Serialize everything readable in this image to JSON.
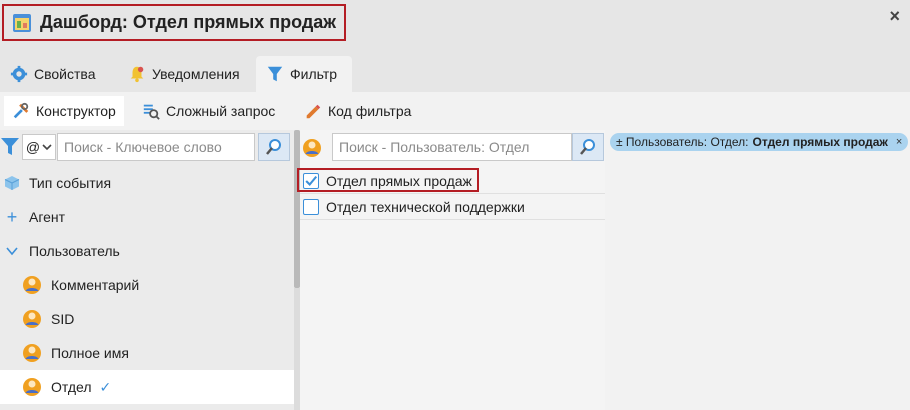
{
  "window": {
    "title": "Дашборд: Отдел прямых продаж",
    "close": "×"
  },
  "tabs": [
    {
      "label": "Свойства",
      "icon": "gear-icon"
    },
    {
      "label": "Уведомления",
      "icon": "bell-icon"
    },
    {
      "label": "Фильтр",
      "icon": "funnel-icon",
      "active": true
    }
  ],
  "subtabs": [
    {
      "label": "Конструктор",
      "icon": "tools-icon",
      "active": true
    },
    {
      "label": "Сложный запрос",
      "icon": "query-icon"
    },
    {
      "label": "Код фильтра",
      "icon": "code-icon"
    }
  ],
  "left": {
    "operator": "@",
    "search_placeholder": "Поиск - Ключевое слово",
    "items": [
      {
        "label": "Тип события",
        "icon": "cube-icon"
      },
      {
        "label": "Агент",
        "icon": "plus-icon"
      },
      {
        "label": "Пользователь",
        "icon": "chevron-down-icon"
      },
      {
        "label": "Комментарий",
        "icon": "user-icon"
      },
      {
        "label": "SID",
        "icon": "user-icon"
      },
      {
        "label": "Полное имя",
        "icon": "user-icon"
      },
      {
        "label": "Отдел",
        "icon": "user-icon",
        "selected": true
      }
    ],
    "selected_mark": "✓"
  },
  "middle": {
    "search_placeholder": "Поиск - Пользователь: Отдел",
    "options": [
      {
        "label": "Отдел прямых продаж",
        "checked": true
      },
      {
        "label": "Отдел технической поддержки",
        "checked": false
      }
    ]
  },
  "right": {
    "chip": {
      "prefix": "± Пользователь: Отдел:",
      "value": "Отдел прямых продаж",
      "remove": "×"
    }
  },
  "colors": {
    "accent": "#3b8fd9",
    "highlight": "#b41d24",
    "chip": "#aad3ef"
  }
}
